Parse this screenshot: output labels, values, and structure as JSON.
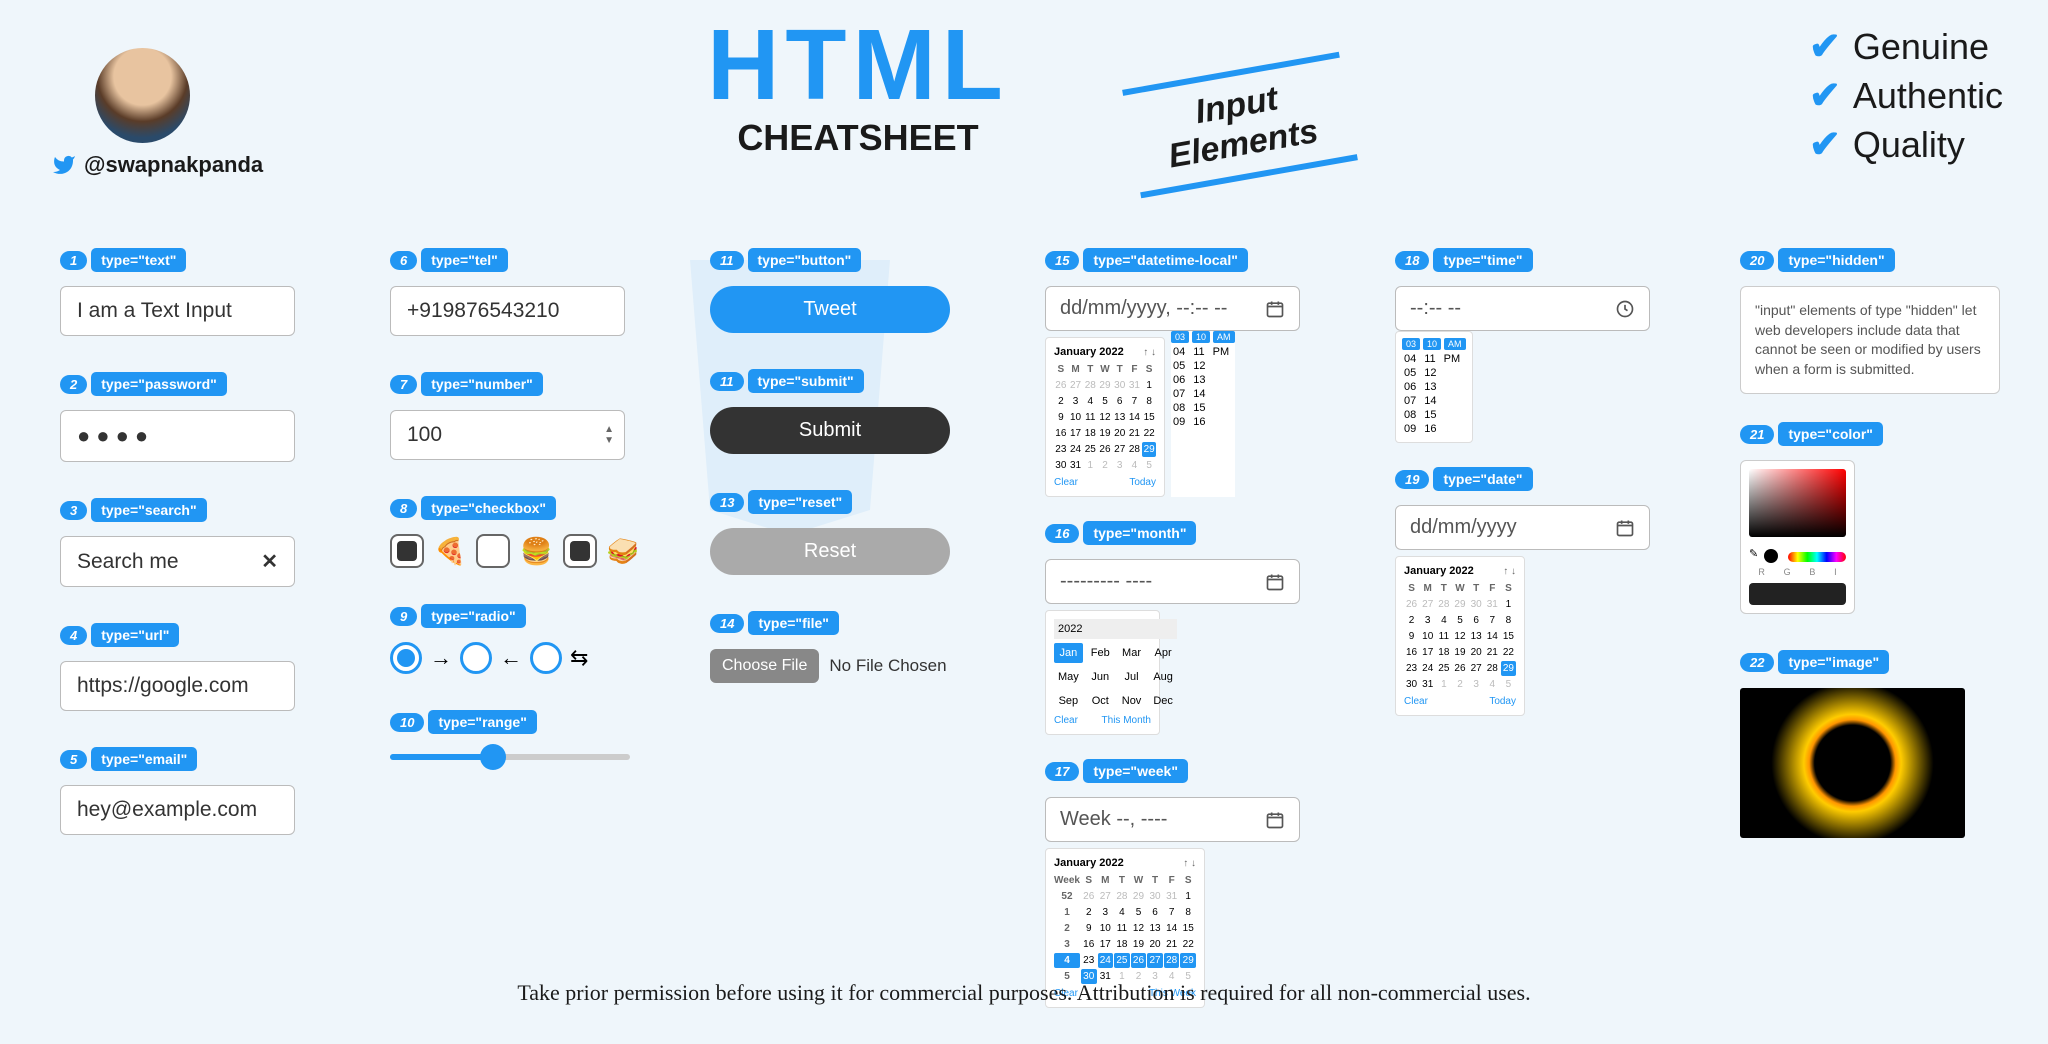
{
  "header": {
    "handle": "@swapnakpanda",
    "title": "HTML",
    "subtitle": "CHEATSHEET",
    "tag_line1": "Input",
    "tag_line2": "Elements",
    "checklist": [
      "Genuine",
      "Authentic",
      "Quality"
    ]
  },
  "inputs": [
    {
      "n": "1",
      "type": "type=\"text\"",
      "value": "I am a Text Input"
    },
    {
      "n": "2",
      "type": "type=\"password\"",
      "value": "●●●●"
    },
    {
      "n": "3",
      "type": "type=\"search\"",
      "value": "Search me"
    },
    {
      "n": "4",
      "type": "type=\"url\"",
      "value": "https://google.com"
    },
    {
      "n": "5",
      "type": "type=\"email\"",
      "value": "hey@example.com"
    },
    {
      "n": "6",
      "type": "type=\"tel\"",
      "value": "+919876543210"
    },
    {
      "n": "7",
      "type": "type=\"number\"",
      "value": "100"
    },
    {
      "n": "8",
      "type": "type=\"checkbox\""
    },
    {
      "n": "9",
      "type": "type=\"radio\""
    },
    {
      "n": "10",
      "type": "type=\"range\""
    },
    {
      "n": "11",
      "type": "type=\"button\"",
      "value": "Tweet"
    },
    {
      "n": "11",
      "type": "type=\"submit\"",
      "value": "Submit"
    },
    {
      "n": "13",
      "type": "type=\"reset\"",
      "value": "Reset"
    },
    {
      "n": "14",
      "type": "type=\"file\"",
      "btn": "Choose File",
      "value": "No File Chosen"
    },
    {
      "n": "15",
      "type": "type=\"datetime-local\"",
      "value": "dd/mm/yyyy, --:-- --"
    },
    {
      "n": "16",
      "type": "type=\"month\"",
      "value": "--------- ----"
    },
    {
      "n": "17",
      "type": "type=\"week\"",
      "value": "Week --, ----"
    },
    {
      "n": "18",
      "type": "type=\"time\"",
      "value": "--:-- --"
    },
    {
      "n": "19",
      "type": "type=\"date\"",
      "value": "dd/mm/yyyy"
    },
    {
      "n": "20",
      "type": "type=\"hidden\"",
      "value": "\"input\" elements of type \"hidden\" let web developers include data that cannot be seen or modified by users when a form is submitted."
    },
    {
      "n": "21",
      "type": "type=\"color\""
    },
    {
      "n": "22",
      "type": "type=\"image\""
    }
  ],
  "calendar": {
    "month_title": "January 2022",
    "weekdays": [
      "S",
      "M",
      "T",
      "W",
      "T",
      "F",
      "S"
    ],
    "clear": "Clear",
    "today": "Today",
    "this_month": "This Month",
    "this_week": "This Week",
    "months": [
      "Jan",
      "Feb",
      "Mar",
      "Apr",
      "May",
      "Jun",
      "Jul",
      "Aug",
      "Sep",
      "Oct",
      "Nov",
      "Dec"
    ],
    "year": "2022",
    "time_headers": [
      "03",
      "10",
      "AM"
    ],
    "time_rows": [
      [
        "04",
        "11",
        "PM"
      ],
      [
        "05",
        "12",
        ""
      ],
      [
        "06",
        "13",
        ""
      ],
      [
        "07",
        "14",
        ""
      ],
      [
        "08",
        "15",
        ""
      ],
      [
        "09",
        "16",
        ""
      ]
    ],
    "week_label": "Week"
  },
  "color_labels": [
    "R",
    "G",
    "B",
    "I"
  ],
  "footer": "Take prior permission before using it for commercial purposes. Attribution is required for all non-commercial uses."
}
